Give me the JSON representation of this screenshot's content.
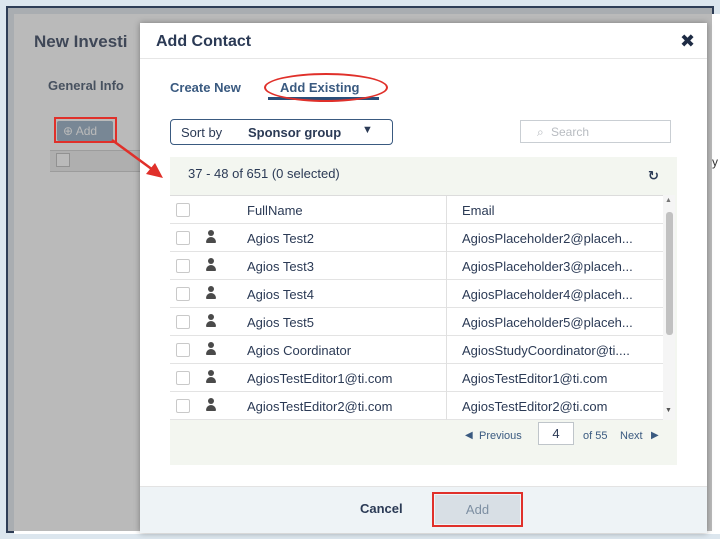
{
  "background": {
    "title": "New Investi",
    "tab_general": "General Info",
    "add_label": "Add",
    "edge_text": "y"
  },
  "modal": {
    "title": "Add Contact",
    "close_icon": "close-icon",
    "tabs": [
      {
        "label": "Create New"
      },
      {
        "label": "Add Existing",
        "active": true
      }
    ],
    "sort": {
      "label": "Sort by",
      "value": "Sponsor group"
    },
    "search": {
      "placeholder": "Search"
    },
    "count_text": "37 - 48 of 651 (0 selected)",
    "table": {
      "columns": [
        "FullName",
        "Email"
      ],
      "rows": [
        {
          "name": "Agios Test2",
          "email": "AgiosPlaceholder2@placeh..."
        },
        {
          "name": "Agios Test3",
          "email": "AgiosPlaceholder3@placeh..."
        },
        {
          "name": "Agios Test4",
          "email": "AgiosPlaceholder4@placeh..."
        },
        {
          "name": "Agios Test5",
          "email": "AgiosPlaceholder5@placeh..."
        },
        {
          "name": "Agios Coordinator",
          "email": "AgiosStudyCoordinator@ti...."
        },
        {
          "name": "AgiosTestEditor1@ti.com",
          "email": "AgiosTestEditor1@ti.com"
        },
        {
          "name": "AgiosTestEditor2@ti.com",
          "email": "AgiosTestEditor2@ti.com"
        }
      ]
    },
    "pager": {
      "previous": "Previous",
      "page": "4",
      "of_text": "of 55",
      "next": "Next"
    },
    "footer": {
      "cancel": "Cancel",
      "add": "Add"
    }
  },
  "colors": {
    "annotation": "#e0302a",
    "accent": "#2a4f7a",
    "text": "#2b3a55"
  }
}
